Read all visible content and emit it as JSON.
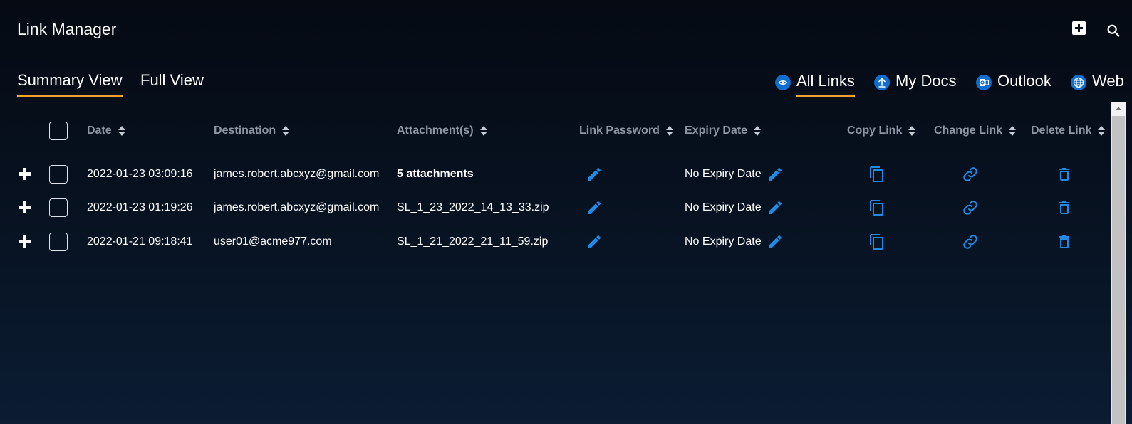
{
  "app": {
    "title": "Link Manager"
  },
  "toolbar": {
    "add_icon": "plus-box-icon",
    "search_icon": "search-icon"
  },
  "views": [
    {
      "label": "Summary View",
      "active": true
    },
    {
      "label": "Full View",
      "active": false
    }
  ],
  "filters": [
    {
      "label": "All Links",
      "icon": "eye-icon",
      "active": true
    },
    {
      "label": "My Docs",
      "icon": "upload-icon",
      "active": false
    },
    {
      "label": "Outlook",
      "icon": "outlook-icon",
      "active": false
    },
    {
      "label": "Web",
      "icon": "globe-icon",
      "active": false
    }
  ],
  "table": {
    "columns": {
      "date": "Date",
      "destination": "Destination",
      "attachments": "Attachment(s)",
      "link_password": "Link Password",
      "expiry_date": "Expiry Date",
      "copy_link": "Copy Link",
      "change_link": "Change Link",
      "delete_link": "Delete Link"
    },
    "rows": [
      {
        "date": "2022-01-23 03:09:16",
        "destination": "james.robert.abcxyz@gmail.com",
        "attachments": "5 attachments",
        "expiry": "No Expiry Date"
      },
      {
        "date": "2022-01-23 01:19:26",
        "destination": "james.robert.abcxyz@gmail.com",
        "attachments": "SL_1_23_2022_14_13_33.zip",
        "expiry": "No Expiry Date"
      },
      {
        "date": "2022-01-21 09:18:41",
        "destination": "user01@acme977.com",
        "attachments": "SL_1_21_2022_21_11_59.zip",
        "expiry": "No Expiry Date"
      }
    ]
  },
  "colors": {
    "accent": "#f0a22e",
    "icon_blue": "#1f8be6",
    "badge_blue": "#0f6fd1",
    "header_text": "#8d96a3"
  }
}
